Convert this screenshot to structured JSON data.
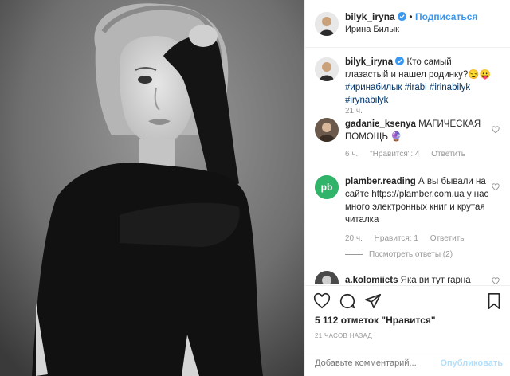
{
  "post": {
    "author": "bilyk_iryna",
    "follow_label": "Подписаться",
    "separator": "•",
    "location": "Ирина Билык"
  },
  "caption": {
    "author": "bilyk_iryna",
    "text": "Кто самый глазастый и нашел родинку?😏😛",
    "hashtags": [
      "#иринабилык",
      "#irabi",
      "#irinabilyk",
      "#irynabilyk"
    ],
    "time": "21 ч."
  },
  "comments": [
    {
      "author": "gadanie_ksenya",
      "text": "МАГИЧЕСКАЯ ПОМОЩЬ 🔮",
      "time": "6 ч.",
      "likes": "\"Нравится\": 4",
      "reply": "Ответить"
    },
    {
      "author": "plamber.reading",
      "text": "А вы бывали на сайте https://plamber.com.ua у нас много электронных книг и крутая читалка",
      "time": "20 ч.",
      "likes": "Нравится: 1",
      "reply": "Ответить",
      "view_replies": "Посмотреть ответы (2)"
    },
    {
      "author": "a.kolomiiets",
      "text": "Яка ви тут гарна"
    }
  ],
  "footer": {
    "likes": "5 112 отметок \"Нравится\"",
    "time_ago": "21 ЧАСОВ НАЗАД",
    "comment_placeholder": "Добавьте комментарий...",
    "publish_label": "Опубликовать"
  },
  "colors": {
    "link": "#3897f0",
    "hashtag": "#003569",
    "muted": "#999999",
    "publish_disabled": "#b2dffc"
  },
  "icons": [
    "verified-icon",
    "heart-icon",
    "comment-icon",
    "share-icon",
    "bookmark-icon",
    "crystal-ball-icon",
    "pb-logo"
  ]
}
